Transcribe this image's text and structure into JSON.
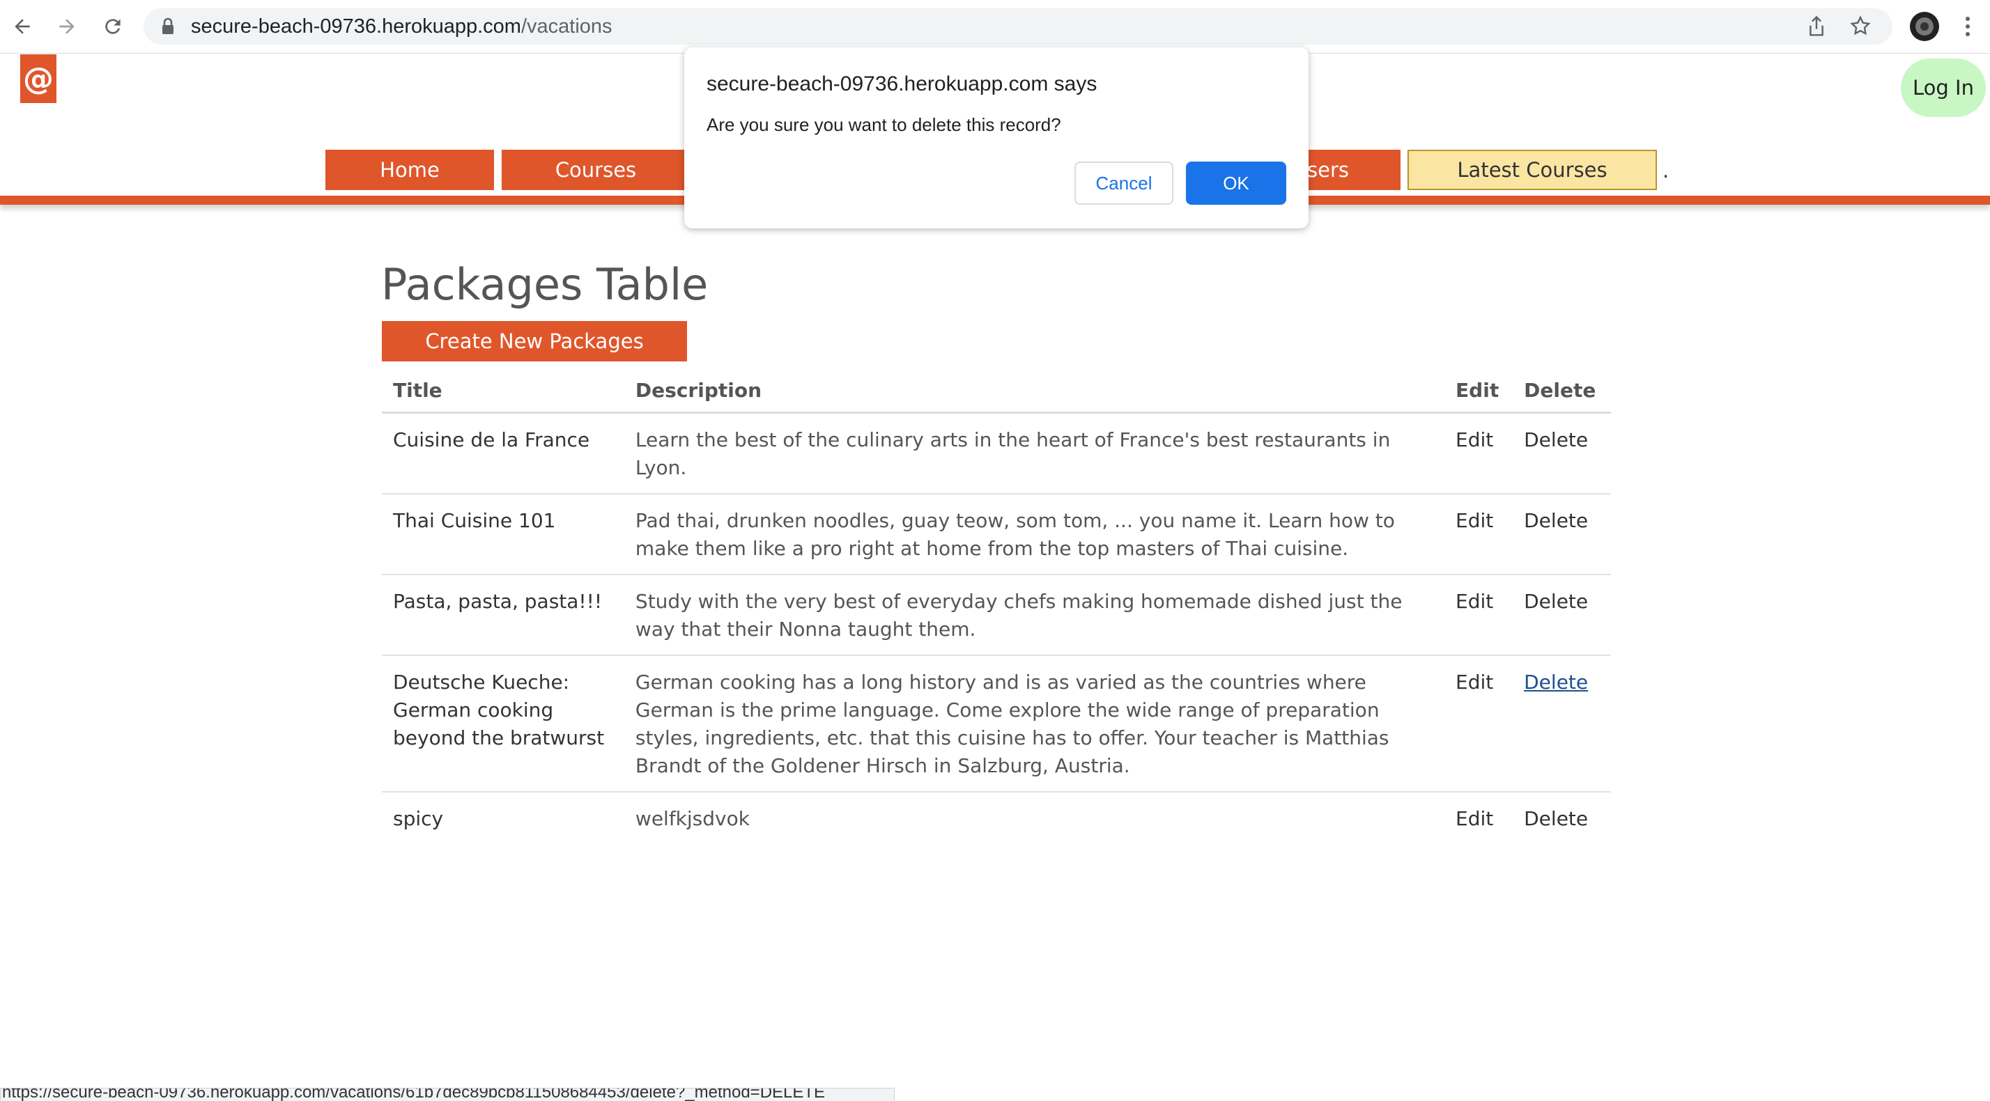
{
  "browser": {
    "url_host": "secure-beach-09736.herokuapp.com",
    "url_path": "/vacations",
    "status_url": "https://secure-beach-09736.herokuapp.com/vacations/61b7dec89bcb811508684453/delete?_method=DELETE"
  },
  "header": {
    "logo_text": "@",
    "login_label": "Log In"
  },
  "nav": {
    "items": [
      "Home",
      "Courses",
      "sers",
      "Latest Courses"
    ],
    "trailing": "."
  },
  "page": {
    "title": "Packages Table",
    "create_label": "Create New Packages"
  },
  "table": {
    "headers": {
      "title": "Title",
      "description": "Description",
      "edit": "Edit",
      "delete": "Delete"
    },
    "rows": [
      {
        "title": "Cuisine de la France",
        "description": "Learn the best of the culinary arts in the heart of France's best restaurants in Lyon.",
        "edit": "Edit",
        "delete": "Delete"
      },
      {
        "title": "Thai Cuisine 101",
        "description": "Pad thai, drunken noodles, guay teow, som tom, ... you name it. Learn how to make them like a pro right at home from the top masters of Thai cuisine.",
        "edit": "Edit",
        "delete": "Delete"
      },
      {
        "title": "Pasta, pasta, pasta!!!",
        "description": "Study with the very best of everyday chefs making homemade dished just the way that their Nonna taught them.",
        "edit": "Edit",
        "delete": "Delete"
      },
      {
        "title": "Deutsche Kueche: German cooking beyond the bratwurst",
        "description": "German cooking has a long history and is as varied as the countries where German is the prime language. Come explore the wide range of preparation styles, ingredients, etc. that this cuisine has to offer. Your teacher is Matthias Brandt of the Goldener Hirsch in Salzburg, Austria.",
        "edit": "Edit",
        "delete": "Delete"
      },
      {
        "title": "spicy",
        "description": "welfkjsdvok",
        "edit": "Edit",
        "delete": "Delete"
      }
    ]
  },
  "dialog": {
    "title": "secure-beach-09736.herokuapp.com says",
    "message": "Are you sure you want to delete this record?",
    "cancel_label": "Cancel",
    "ok_label": "OK"
  },
  "colors": {
    "brand": "#e0562b",
    "latest_bg": "#fbe5a2",
    "login_bg": "#c9f7c4",
    "dialog_ok": "#1a73e8"
  }
}
